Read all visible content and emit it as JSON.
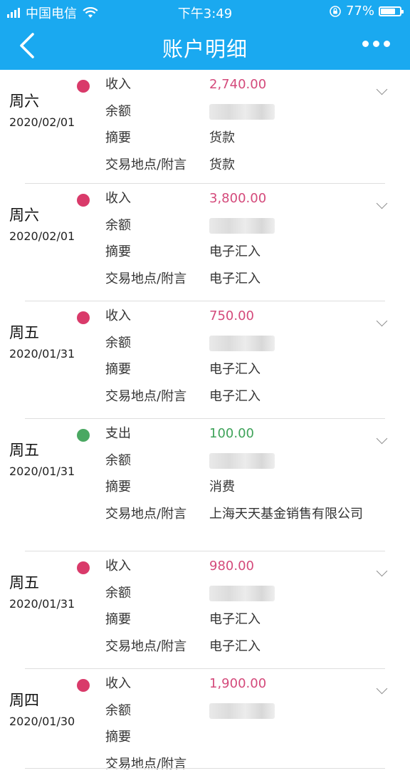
{
  "status": {
    "carrier": "中国电信",
    "time": "下午3:49",
    "battery": "77%",
    "battery_level": 0.77
  },
  "nav": {
    "title": "账户明细"
  },
  "records": [
    {
      "weekday": "周六",
      "date": "2020/02/01",
      "type_label": "收入",
      "amount": "2,740.00",
      "direction": "in",
      "balance_label": "余额",
      "summary_label": "摘要",
      "summary": "货款",
      "place_label": "交易地点/附言",
      "place": "货款"
    },
    {
      "weekday": "周六",
      "date": "2020/02/01",
      "type_label": "收入",
      "amount": "3,800.00",
      "direction": "in",
      "balance_label": "余额",
      "summary_label": "摘要",
      "summary": "电子汇入",
      "place_label": "交易地点/附言",
      "place": "电子汇入"
    },
    {
      "weekday": "周五",
      "date": "2020/01/31",
      "type_label": "收入",
      "amount": "750.00",
      "direction": "in",
      "balance_label": "余额",
      "summary_label": "摘要",
      "summary": "电子汇入",
      "place_label": "交易地点/附言",
      "place": "电子汇入"
    },
    {
      "weekday": "周五",
      "date": "2020/01/31",
      "type_label": "支出",
      "amount": "100.00",
      "direction": "out",
      "balance_label": "余额",
      "summary_label": "摘要",
      "summary": "消费",
      "place_label": "交易地点/附言",
      "place": "上海天天基金销售有限公司"
    },
    {
      "weekday": "周五",
      "date": "2020/01/31",
      "type_label": "收入",
      "amount": "980.00",
      "direction": "in",
      "balance_label": "余额",
      "summary_label": "摘要",
      "summary": "电子汇入",
      "place_label": "交易地点/附言",
      "place": "电子汇入"
    },
    {
      "weekday": "周四",
      "date": "2020/01/30",
      "type_label": "收入",
      "amount": "1,900.00",
      "direction": "in",
      "balance_label": "余额",
      "summary_label": "摘要",
      "summary": "",
      "place_label": "交易地点/附言",
      "place": ""
    }
  ],
  "colors": {
    "header": "#1aa9f0",
    "income": "#d44a7b",
    "expense": "#3fa35a",
    "income_dot": "#d93a6a",
    "expense_dot": "#4aa862"
  }
}
